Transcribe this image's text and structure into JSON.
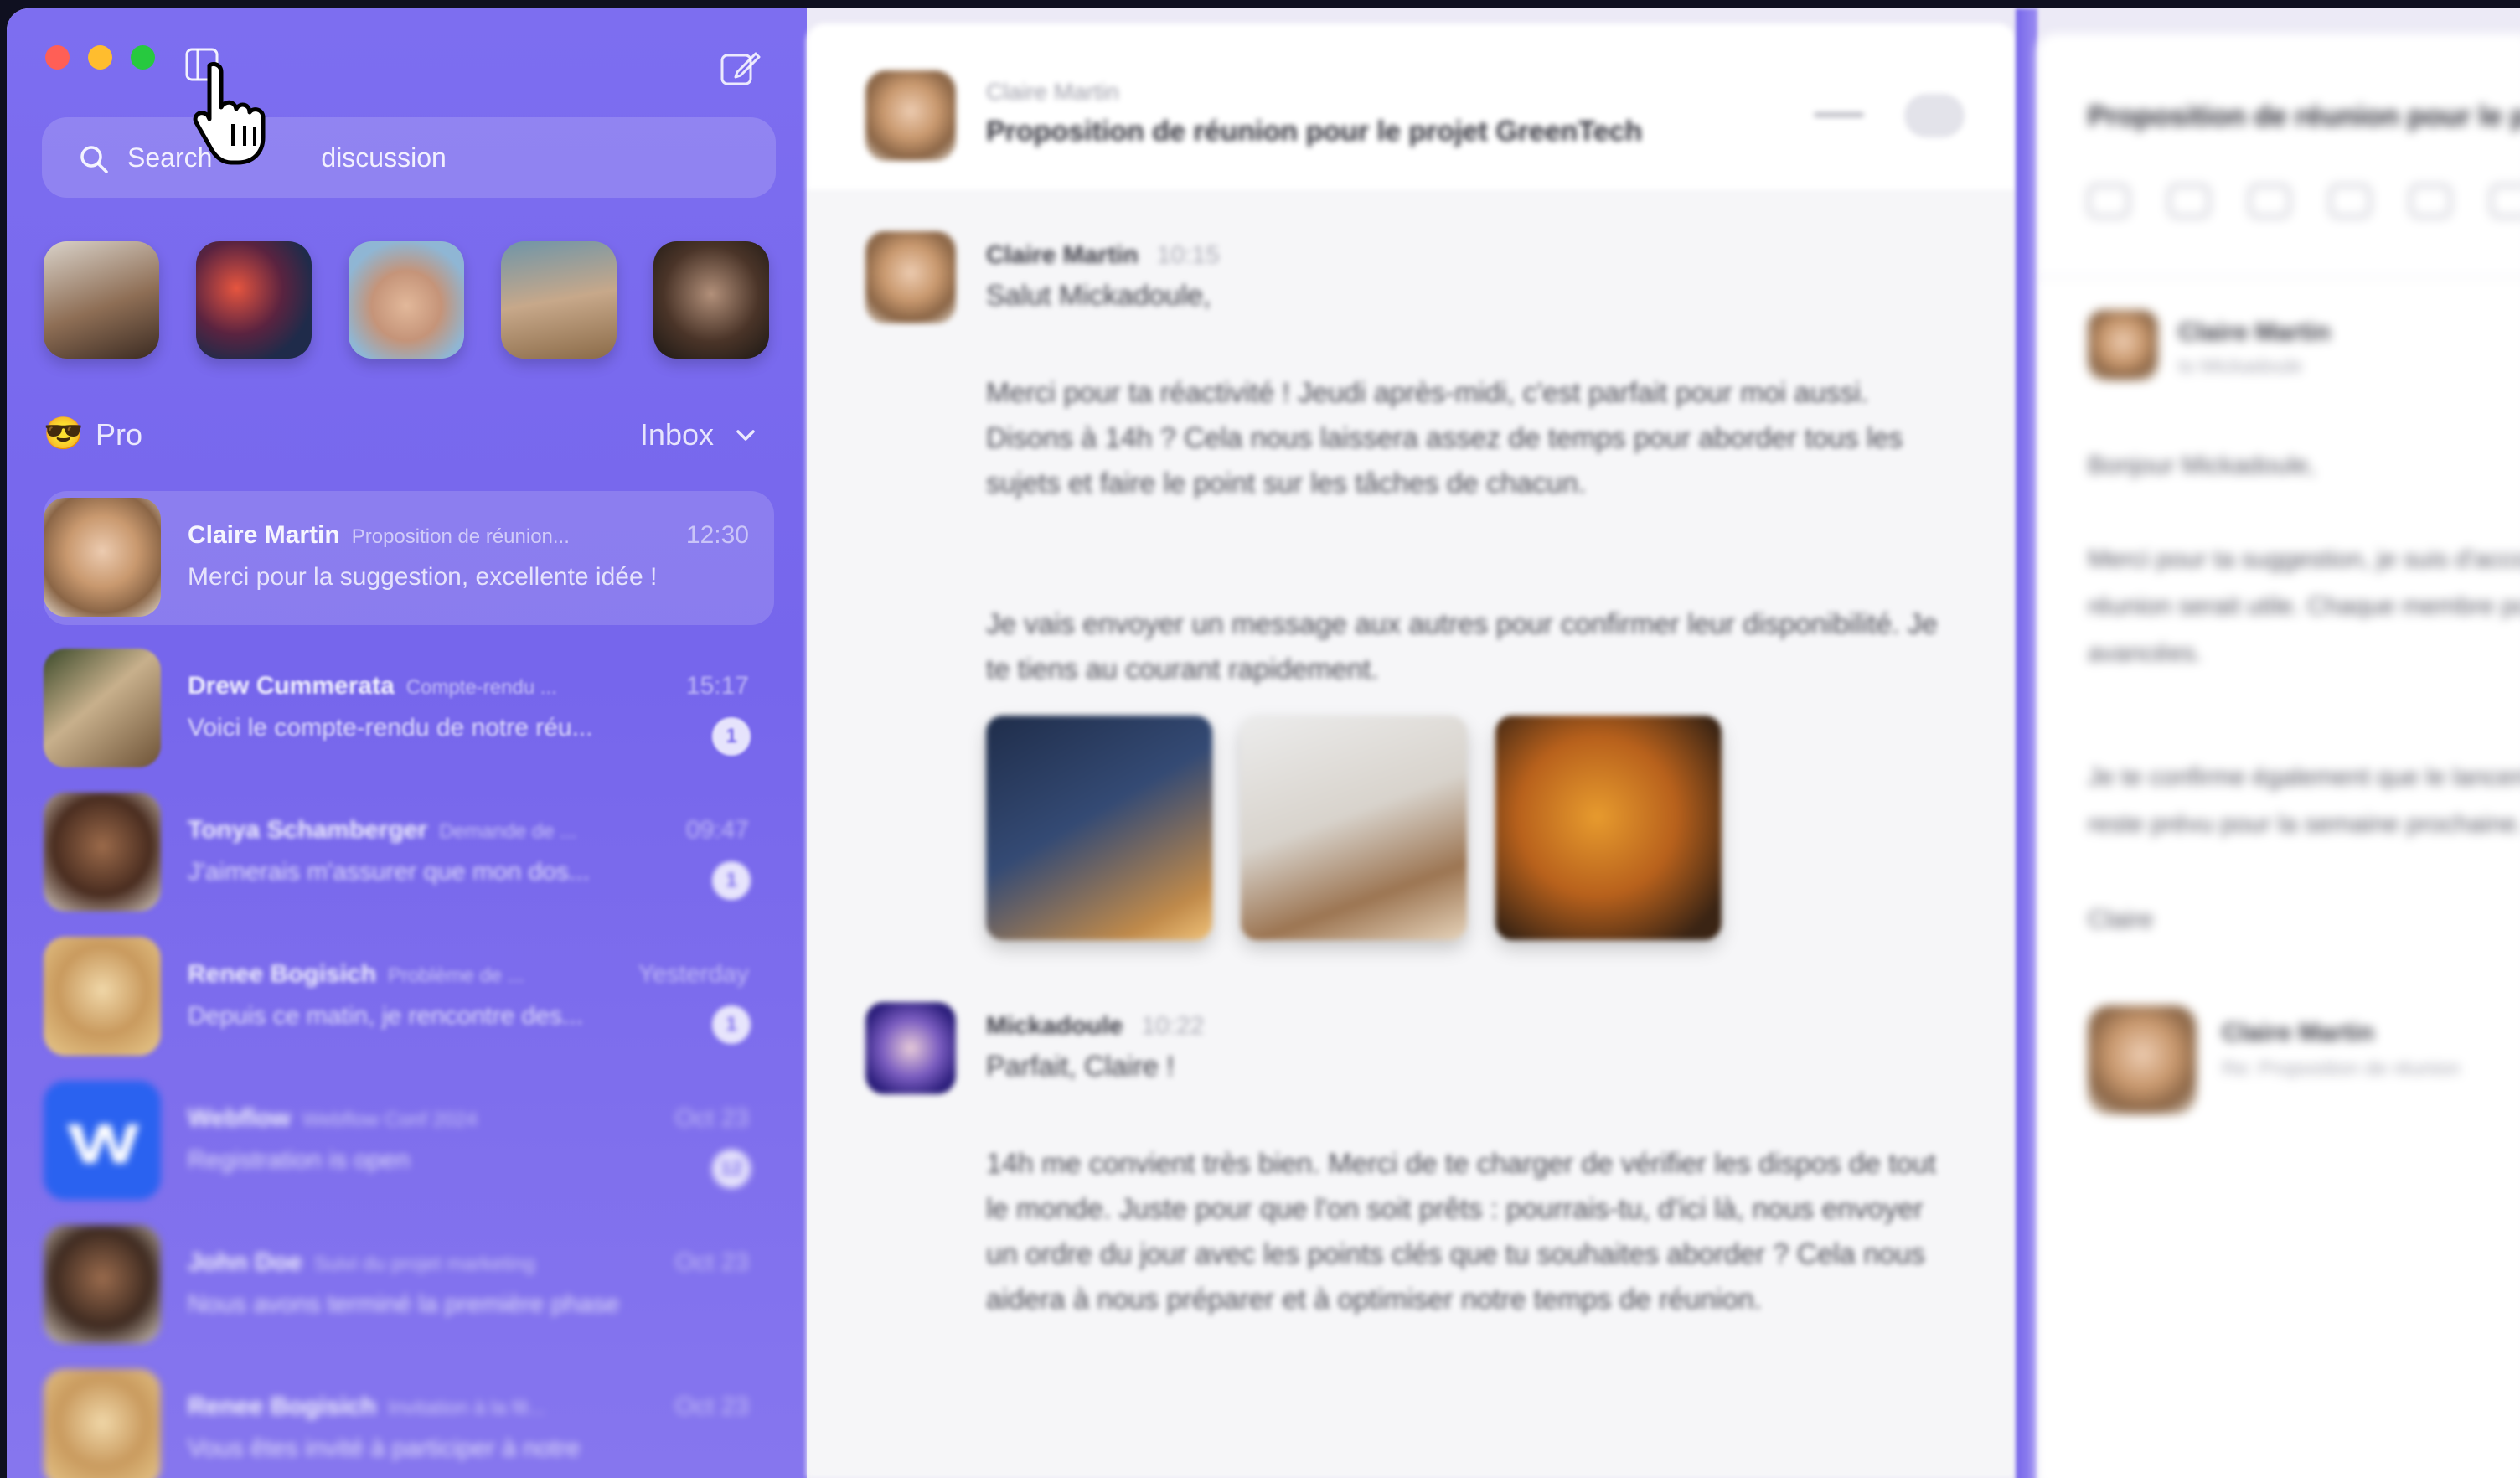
{
  "sidebar": {
    "search_placeholder": "Search",
    "search_placeholder_end": "discussion",
    "favorites": [
      {
        "name": "favorite-1"
      },
      {
        "name": "favorite-2"
      },
      {
        "name": "favorite-3"
      },
      {
        "name": "favorite-4"
      },
      {
        "name": "favorite-5"
      }
    ],
    "section": {
      "emoji": "😎",
      "label": "Pro",
      "folder": "Inbox"
    },
    "threads": [
      {
        "sender": "Claire Martin",
        "subject": "Proposition de réunion...",
        "time": "12:30",
        "preview": "Merci pour la suggestion, excellente idée !",
        "badge": "",
        "active": true
      },
      {
        "sender": "Drew Cummerata",
        "subject": "Compte-rendu ...",
        "time": "15:17",
        "preview": "Voici le compte-rendu de notre réu...",
        "badge": "1"
      },
      {
        "sender": "Tonya Schamberger",
        "subject": "Demande de ...",
        "time": "09:47",
        "preview": "J'aimerais m'assurer que mon dos...",
        "badge": "1"
      },
      {
        "sender": "Renee Bogisich",
        "subject": "Problème de ...",
        "time": "Yesterday",
        "preview": "Depuis ce matin, je rencontre des...",
        "badge": "1"
      },
      {
        "sender": "Webflow",
        "subject": "Webflow Conf 2024",
        "time": "Oct 23",
        "preview": "Registration is open",
        "badge": "12"
      },
      {
        "sender": "John Doe",
        "subject": "Suivi du projet marketing",
        "time": "Oct 23",
        "preview": "Nous avons terminé la première phase",
        "badge": ""
      },
      {
        "sender": "Renee Bogisich",
        "subject": "Invitation à la fê...",
        "time": "Oct 23",
        "preview": "Vous êtes invité à participer à notre",
        "badge": ""
      }
    ]
  },
  "conversation": {
    "header": {
      "from": "Claire Martin",
      "title": "Proposition de réunion pour le projet GreenTech"
    },
    "messages": [
      {
        "author": "Claire Martin",
        "time": "10:15",
        "greeting": "Salut Mickadoule,",
        "paragraphs": [
          "Merci pour ta réactivité ! Jeudi après-midi, c'est parfait pour moi aussi. Disons à 14h ? Cela nous laissera assez de temps pour aborder tous les sujets et faire le point sur les tâches de chacun.",
          "Je vais envoyer un message aux autres pour confirmer leur disponibilité. Je te tiens au courant rapidement."
        ]
      },
      {
        "author": "Mickadoule",
        "time": "10:22",
        "greeting": "Parfait, Claire !",
        "paragraphs": [
          "14h me convient très bien. Merci de te charger de vérifier les dispos de tout le monde. Juste pour que l'on soit prêts : pourrais-tu, d'ici là, nous envoyer un ordre du jour avec les points clés que tu souhaites aborder ? Cela nous aidera à nous préparer et à optimiser notre temps de réunion."
        ]
      }
    ]
  },
  "detail": {
    "title": "Proposition de réunion pour le projet",
    "sender": "Claire Martin",
    "sender_sub": "to Mickadoule",
    "greeting": "Bonjour Mickadoule,",
    "p1": "Merci pour ta suggestion, je suis d'accord avec toi. Une réunion serait utile. Chaque membre pourra partager ses avancées.",
    "p2": "Je te confirme également que le lancement pour le GreenTech reste prévu pour la semaine prochaine.",
    "signoff": "Claire",
    "reply_sender": "Claire Martin",
    "reply_sub": "Re: Proposition de réunion"
  },
  "colors": {
    "sidebar": "#7666ec",
    "accent": "#7d6ef0",
    "badge_text": "#7666ec",
    "content_bg": "#f6f6f8"
  }
}
